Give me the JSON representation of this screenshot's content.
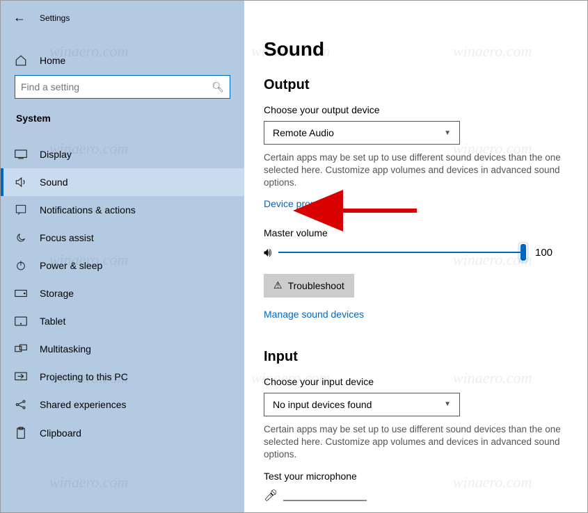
{
  "titlebar": {
    "title": "Settings"
  },
  "sidebar": {
    "home_label": "Home",
    "search_placeholder": "Find a setting",
    "category": "System",
    "items": [
      {
        "label": "Display"
      },
      {
        "label": "Sound"
      },
      {
        "label": "Notifications & actions"
      },
      {
        "label": "Focus assist"
      },
      {
        "label": "Power & sleep"
      },
      {
        "label": "Storage"
      },
      {
        "label": "Tablet"
      },
      {
        "label": "Multitasking"
      },
      {
        "label": "Projecting to this PC"
      },
      {
        "label": "Shared experiences"
      },
      {
        "label": "Clipboard"
      }
    ]
  },
  "main": {
    "page_title": "Sound",
    "output": {
      "section_title": "Output",
      "choose_label": "Choose your output device",
      "selected": "Remote Audio",
      "helper": "Certain apps may be set up to use different sound devices than the one selected here. Customize app volumes and devices in advanced sound options.",
      "device_props": "Device properties",
      "master_label": "Master volume",
      "master_value": "100",
      "troubleshoot": "Troubleshoot",
      "manage": "Manage sound devices"
    },
    "input": {
      "section_title": "Input",
      "choose_label": "Choose your input device",
      "selected": "No input devices found",
      "helper": "Certain apps may be set up to use different sound devices than the one selected here. Customize app volumes and devices in advanced sound options.",
      "test_label": "Test your microphone"
    }
  },
  "watermark": "winaero.com"
}
